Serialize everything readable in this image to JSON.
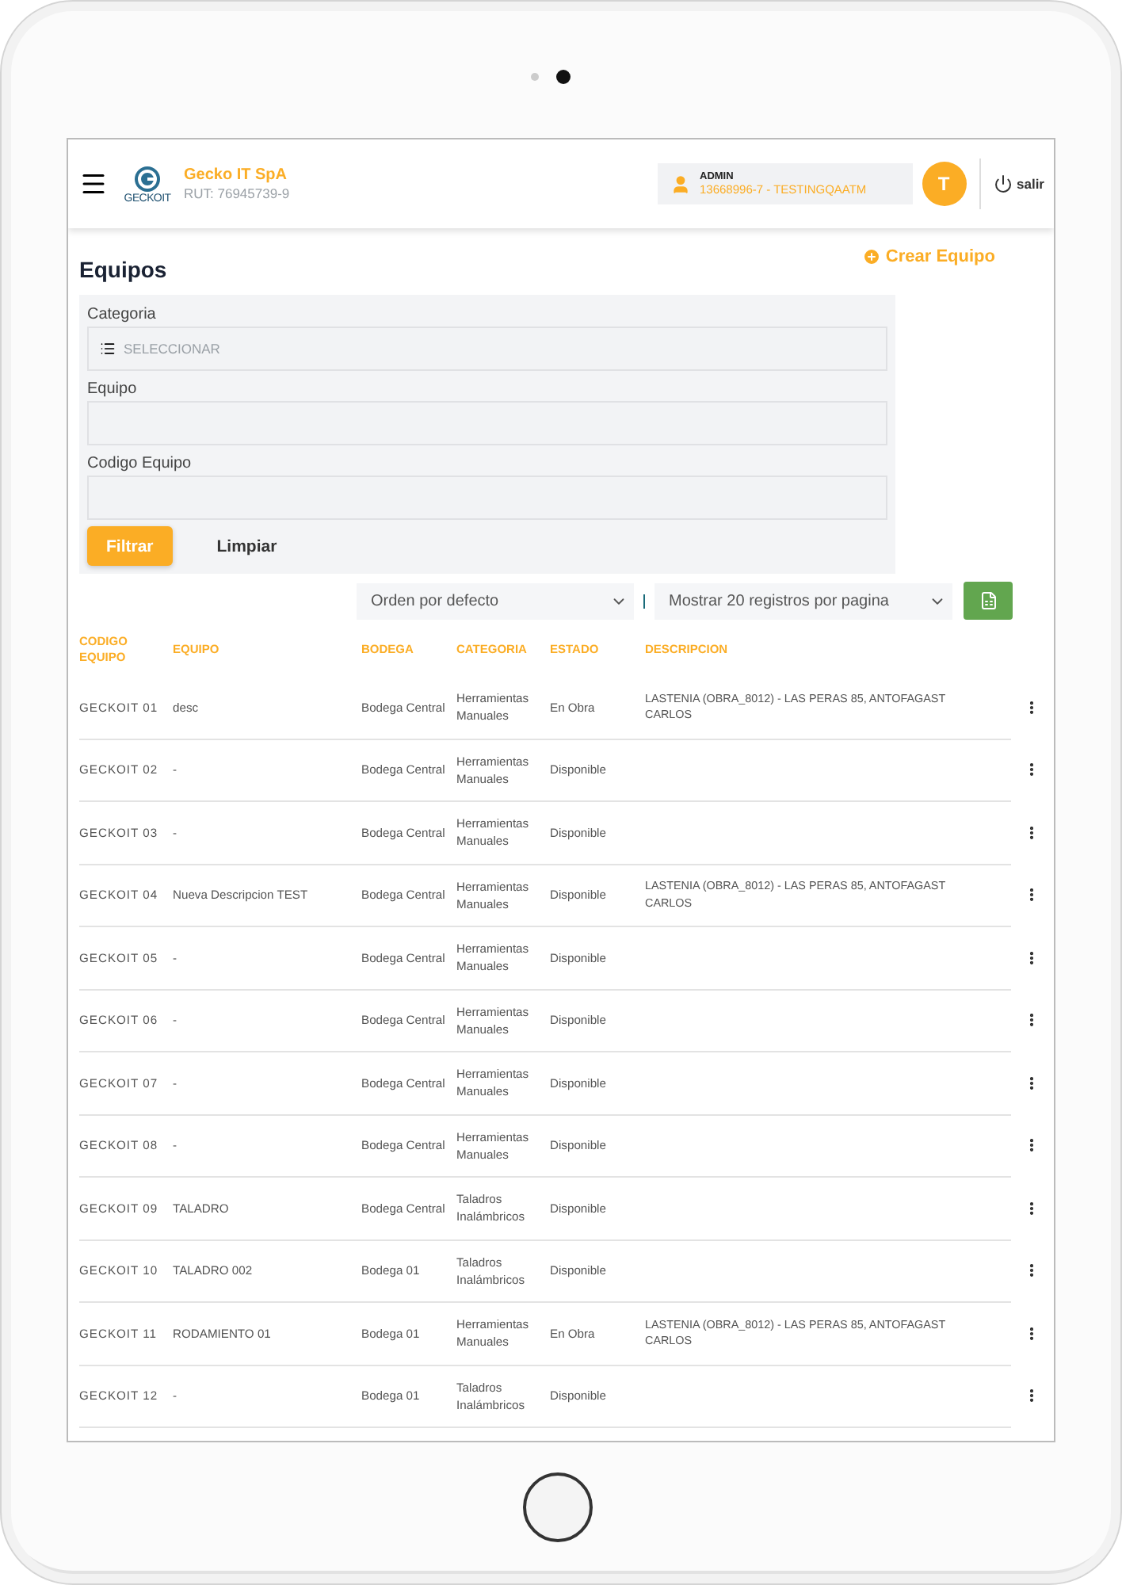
{
  "header": {
    "logo_text": "GECKOIT",
    "company": "Gecko IT SpA",
    "rut": "RUT: 76945739-9",
    "user_role": "ADMIN",
    "user_account": "13668996-7 - TESTINGQAATM",
    "avatar": "T",
    "logout": "salir"
  },
  "page": {
    "title": "Equipos",
    "create_button": "Crear Equipo"
  },
  "filters": {
    "fields": [
      {
        "kind": "select",
        "label": "Categoria",
        "placeholder": "SELECCIONAR"
      },
      {
        "kind": "text",
        "label": "Equipo"
      },
      {
        "kind": "text",
        "label": "Codigo Equipo"
      }
    ],
    "buttons": [
      "Filtrar",
      "Limpiar"
    ]
  },
  "toolbar": {
    "sort": "Orden por defecto",
    "page_size": "Mostrar 20 registros por pagina"
  },
  "table": {
    "columns": [
      "CODIGO EQUIPO",
      "EQUIPO",
      "BODEGA",
      "CATEGORIA",
      "ESTADO",
      "DESCRIPCION"
    ],
    "rows": [
      {
        "code": "GECKOIT 01",
        "equipment": "desc",
        "warehouse": "Bodega Central",
        "category": "Herramientas Manuales",
        "status": "En Obra",
        "description": [
          "LASTENIA (OBRA_8012) - LAS PERAS 85, ANTOFAGAST",
          "CARLOS"
        ]
      },
      {
        "code": "GECKOIT 02",
        "equipment": "-",
        "warehouse": "Bodega Central",
        "category": "Herramientas Manuales",
        "status": "Disponible"
      },
      {
        "code": "GECKOIT 03",
        "equipment": "-",
        "warehouse": "Bodega Central",
        "category": "Herramientas Manuales",
        "status": "Disponible"
      },
      {
        "code": "GECKOIT 04",
        "equipment": "Nueva Descripcion TEST",
        "warehouse": "Bodega Central",
        "category": "Herramientas Manuales",
        "status": "Disponible",
        "description": [
          "LASTENIA (OBRA_8012) - LAS PERAS 85, ANTOFAGAST",
          "CARLOS"
        ]
      },
      {
        "code": "GECKOIT 05",
        "equipment": "-",
        "warehouse": "Bodega Central",
        "category": "Herramientas Manuales",
        "status": "Disponible"
      },
      {
        "code": "GECKOIT 06",
        "equipment": "-",
        "warehouse": "Bodega Central",
        "category": "Herramientas Manuales",
        "status": "Disponible"
      },
      {
        "code": "GECKOIT 07",
        "equipment": "-",
        "warehouse": "Bodega Central",
        "category": "Herramientas Manuales",
        "status": "Disponible"
      },
      {
        "code": "GECKOIT 08",
        "equipment": "-",
        "warehouse": "Bodega Central",
        "category": "Herramientas Manuales",
        "status": "Disponible"
      },
      {
        "code": "GECKOIT 09",
        "equipment": "TALADRO",
        "warehouse": "Bodega Central",
        "category": "Taladros Inalámbricos",
        "status": "Disponible"
      },
      {
        "code": "GECKOIT 10",
        "equipment": "TALADRO 002",
        "warehouse": "Bodega 01",
        "category": "Taladros Inalámbricos",
        "status": "Disponible"
      },
      {
        "code": "GECKOIT 11",
        "equipment": "RODAMIENTO 01",
        "warehouse": "Bodega 01",
        "category": "Herramientas Manuales",
        "status": "En Obra",
        "description": [
          "LASTENIA (OBRA_8012) - LAS PERAS 85, ANTOFAGAST",
          "CARLOS"
        ]
      },
      {
        "code": "GECKOIT 12",
        "equipment": "-",
        "warehouse": "Bodega 01",
        "category": "Taladros Inalámbricos",
        "status": "Disponible"
      }
    ]
  }
}
